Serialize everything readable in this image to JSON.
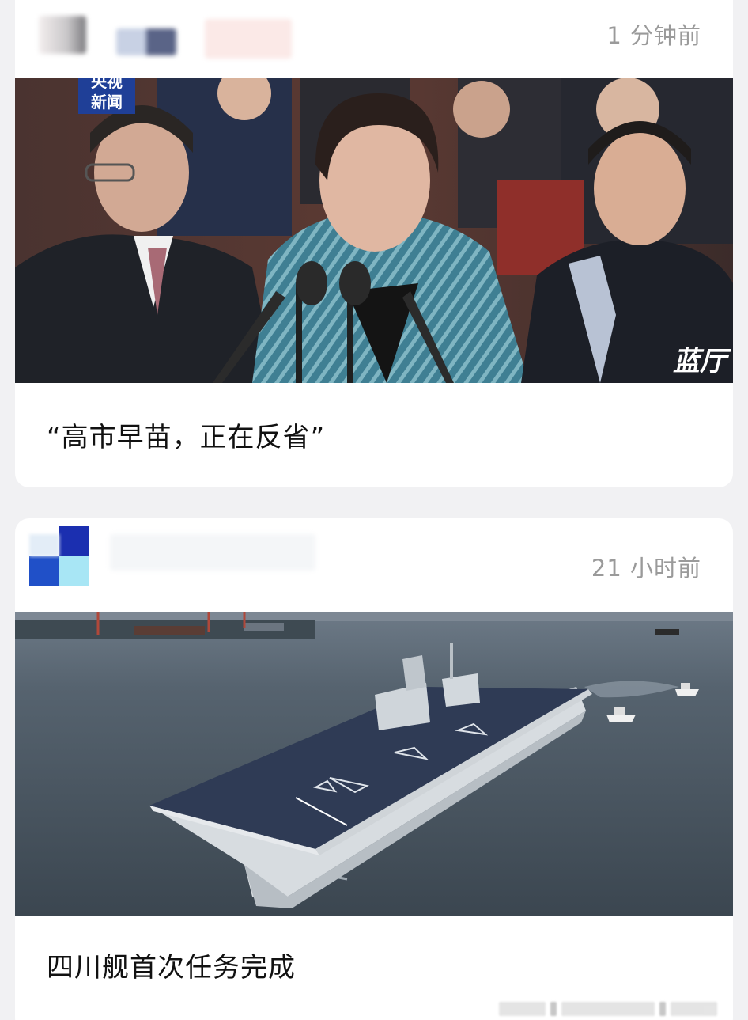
{
  "feed": {
    "posts": [
      {
        "time": "1 分钟前",
        "title": "“高市早苗，正在反省”",
        "media_overlay": {
          "channel_logo_line1": "央视",
          "channel_logo_line2": "新闻",
          "corner_logo": "蓝厅"
        }
      },
      {
        "time": "21 小时前",
        "title": "四川舰首次任务完成"
      }
    ]
  }
}
